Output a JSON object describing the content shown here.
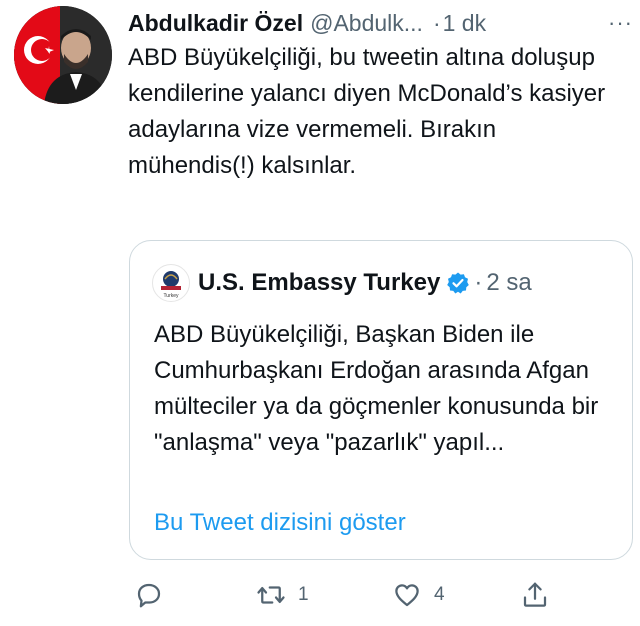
{
  "tweet": {
    "author_name": "Abdulkadir Özel",
    "author_handle": "@Abdulk...",
    "separator": "·",
    "time": "1 dk",
    "more": "···",
    "text": "ABD Büyükelçiliği, bu tweetin altına doluşup kendilerine yalancı diyen McDonald’s kasiyer adaylarına vize vermemeli. Bırakın mühendis(!) kalsınlar."
  },
  "quote": {
    "author_name": "U.S. Embassy Turkey",
    "avatar_caption": "Turkey",
    "separator": "·",
    "time": "2 sa",
    "text": "ABD Büyükelçiliği, Başkan Biden ile Cumhurbaşkanı Erdoğan arasında Afgan mülteciler ya da göçmenler konusunda bir \"anlaşma\" veya \"pazarlık\" yapıl...",
    "show_thread_label": "Bu Tweet dizisini göster"
  },
  "actions": {
    "reply": {
      "icon": "reply-icon"
    },
    "retweet": {
      "icon": "retweet-icon",
      "count": "1"
    },
    "like": {
      "icon": "heart-icon",
      "count": "4"
    },
    "share": {
      "icon": "share-icon"
    }
  },
  "colors": {
    "text": "#0f1419",
    "muted": "#536471",
    "link": "#1d9bf0",
    "border": "#cfd9de",
    "flag_red": "#e30a17"
  }
}
